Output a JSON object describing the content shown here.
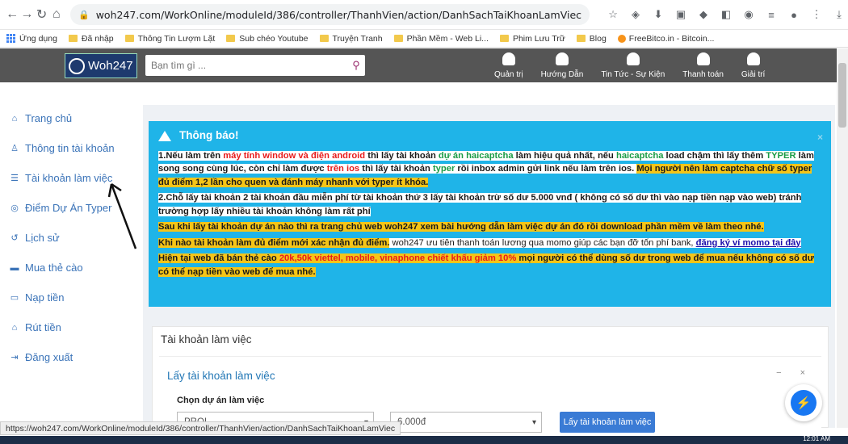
{
  "browser": {
    "url": "woh247.com/WorkOnline/moduleId/386/controller/ThanhVien/action/DanhSachTaiKhoanLamViec",
    "bookmarks": [
      "Ứng dụng",
      "Đã nhập",
      "Thông Tin Lượm Lặt",
      "Sub chéo Youtube",
      "Truyện Tranh",
      "Phần Mềm - Web Li...",
      "Phim Lưu Trữ",
      "Blog",
      "FreeBitco.in - Bitcoin..."
    ]
  },
  "header": {
    "logo_text": "Woh247",
    "search_placeholder": "Bạn tìm gì ...",
    "menu": [
      "Quản trị",
      "Hướng Dẫn",
      "Tin Tức - Sự Kiện",
      "Thanh toán",
      "Giải trí"
    ]
  },
  "sidebar": {
    "items": [
      {
        "label": "Trang chủ",
        "icon": "home-icon",
        "glyph": "⌂"
      },
      {
        "label": "Thông tin tài khoản",
        "icon": "user-icon",
        "glyph": "♙"
      },
      {
        "label": "Tài khoản làm việc",
        "icon": "list-icon",
        "glyph": "☰"
      },
      {
        "label": "Điểm Dự Án Typer",
        "icon": "target-icon",
        "glyph": "◎"
      },
      {
        "label": "Lịch sử",
        "icon": "history-icon",
        "glyph": "↺"
      },
      {
        "label": "Mua thẻ cào",
        "icon": "cart-icon",
        "glyph": "▬"
      },
      {
        "label": "Nạp tiền",
        "icon": "card-icon",
        "glyph": "▭"
      },
      {
        "label": "Rút tiền",
        "icon": "bank-icon",
        "glyph": "⌂"
      },
      {
        "label": "Đăng xuất",
        "icon": "logout-icon",
        "glyph": "⇥"
      }
    ]
  },
  "notice": {
    "title": "Thông báo!",
    "close": "×",
    "p1": {
      "a": "1.Nếu làm trên ",
      "b": "máy tính window và điện android",
      "c": " thì lấy tài khoản ",
      "d": "dự án haicaptcha",
      "e": " làm hiệu quả nhất, nếu ",
      "f": "haicaptcha",
      "g": " load chậm thì lấy thêm ",
      "h": "TYPER",
      "i": " làm song song cùng lúc, còn chỉ làm được ",
      "j": "trên ios",
      "k": " thì lấy tài khoản ",
      "l": "typer",
      "m": " rồi inbox admin gửi link nếu làm trên ios. ",
      "n": "Mọi người nên làm captcha chữ số typer đủ điểm 1,2 lần cho quen và đánh máy nhanh với typer ít khóa."
    },
    "p2": "2.Chỗ lấy tài khoản 2 tài khoản đầu miễn phí từ tài khoản thứ 3 lấy tài khoản trừ số dư 5.000 vnđ ( không có số dư thì vào nạp tiền nạp vào web) tránh trường hợp lấy nhiều tài khoản không làm rất phí",
    "p3": "Sau khi lấy tài khoản dự án nào thì ra trang chủ web woh247 xem bài hướng dẫn làm việc dự án đó rồi download phần mềm về làm theo nhé.",
    "p4": {
      "a": "Khi nào tài khoản làm đủ điểm mới xác nhận đủ điểm.",
      "b": " woh247 ưu tiên thanh toán lương qua momo giúp các bạn đỡ tốn phí bank, ",
      "c": "đăng ký ví momo tại đây"
    },
    "p5": {
      "a": "Hiện tại web đã bán thẻ cào ",
      "b": "20k,50k viettel, mobile, vinaphone chiết khấu giảm 10%",
      "c": " mọi người có thể dùng số dư trong web để mua nếu không có số dư có thể nạp tiền vào web để mua nhé."
    }
  },
  "panel": {
    "title": "Tài khoản làm việc",
    "sub_title": "Lấy tài khoản làm việc",
    "controls": "− ×",
    "field_label": "Chọn dự án làm việc",
    "project_value": "PROI",
    "price_value": "6.000đ",
    "button": "Lấy tài khoản làm việc"
  },
  "status_url": "https://woh247.com/WorkOnline/moduleId/386/controller/ThanhVien/action/DanhSachTaiKhoanLamViec",
  "clock": "12:01 AM"
}
